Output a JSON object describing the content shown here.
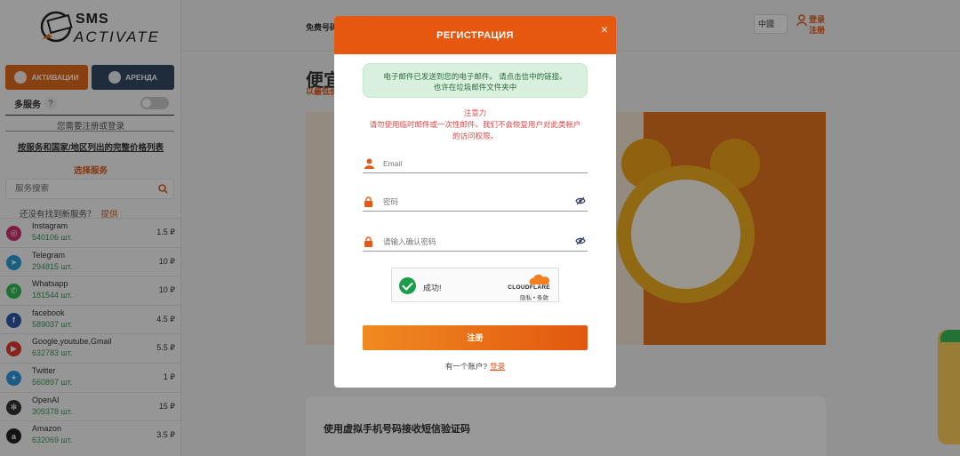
{
  "sidebar": {
    "logo": {
      "line1": "SMS",
      "line2": "ACTIVATE"
    },
    "tabs": {
      "activations": "АКТИВАЦИИ",
      "rent": "АРЕНДА"
    },
    "multi_service_label": "多服务",
    "help_mark": "?",
    "need_login": "您需要注册或登录",
    "price_list_link": "按服务和国家/地区列出的完整价格列表",
    "choose_service": "选择服务",
    "search_placeholder": "服务搜索",
    "not_found": "还没有找到新服务？",
    "provide_link": "提供",
    "services": [
      {
        "name": "Instagram",
        "count": "540106 шт.",
        "price": "1.5 ₽",
        "icon": "instagram-icon",
        "color": "#d6306f",
        "glyph": "◎"
      },
      {
        "name": "Telegram",
        "count": "294815 шт.",
        "price": "10 ₽",
        "icon": "telegram-icon",
        "color": "#2b9fd9",
        "glyph": "➤"
      },
      {
        "name": "Whatsapp",
        "count": "181544 шт.",
        "price": "10 ₽",
        "icon": "whatsapp-icon",
        "color": "#2fbf55",
        "glyph": "✆"
      },
      {
        "name": "facebook",
        "count": "589037 шт.",
        "price": "4.5 ₽",
        "icon": "facebook-icon",
        "color": "#2e5aa8",
        "glyph": "f"
      },
      {
        "name": "Google,youtube,Gmail",
        "count": "632783 шт.",
        "price": "5.5 ₽",
        "icon": "youtube-icon",
        "color": "#e33a2e",
        "glyph": "▶"
      },
      {
        "name": "Twitter",
        "count": "560897 шт.",
        "price": "1 ₽",
        "icon": "twitter-icon",
        "color": "#2f9be3",
        "glyph": "✦"
      },
      {
        "name": "OpenAI",
        "count": "309378 шт.",
        "price": "15 ₽",
        "icon": "openai-icon",
        "color": "#333333",
        "glyph": "✻"
      },
      {
        "name": "Amazon",
        "count": "632069 шт.",
        "price": "3.5 ₽",
        "icon": "amazon-icon",
        "color": "#222222",
        "glyph": "a"
      }
    ]
  },
  "header": {
    "link": "免费号码",
    "lang": "中國",
    "login": "登录",
    "register": "注册"
  },
  "main": {
    "hero_title": "便宜",
    "hero_sub": "以最低价",
    "card_title": "使用虚拟手机号码接收短信验证码"
  },
  "modal": {
    "title": "РЕГИСТРАЦИЯ",
    "close": "×",
    "alert_line1": "电子邮件已发送到您的电子邮件。 请点击信中的链接。",
    "alert_line2": "也许在垃圾邮件文件夹中",
    "warn_title": "注意力",
    "warn_line1": "请勿使用临时邮件或一次性邮件。我们不会恢复用户对此类帐户",
    "warn_line2": "的访问权限。",
    "email_placeholder": "Email",
    "password_placeholder": "密码",
    "confirm_placeholder": "请输入确认密码",
    "captcha_status": "成功!",
    "captcha_brand": "CLOUDFLARE",
    "captcha_links": "隐私 • 条款",
    "submit": "注册",
    "have_account": "有一个账户?",
    "login_link": "登录"
  },
  "colors": {
    "accent": "#e6580f",
    "success": "#1a9e4a",
    "warning": "#e04848"
  }
}
